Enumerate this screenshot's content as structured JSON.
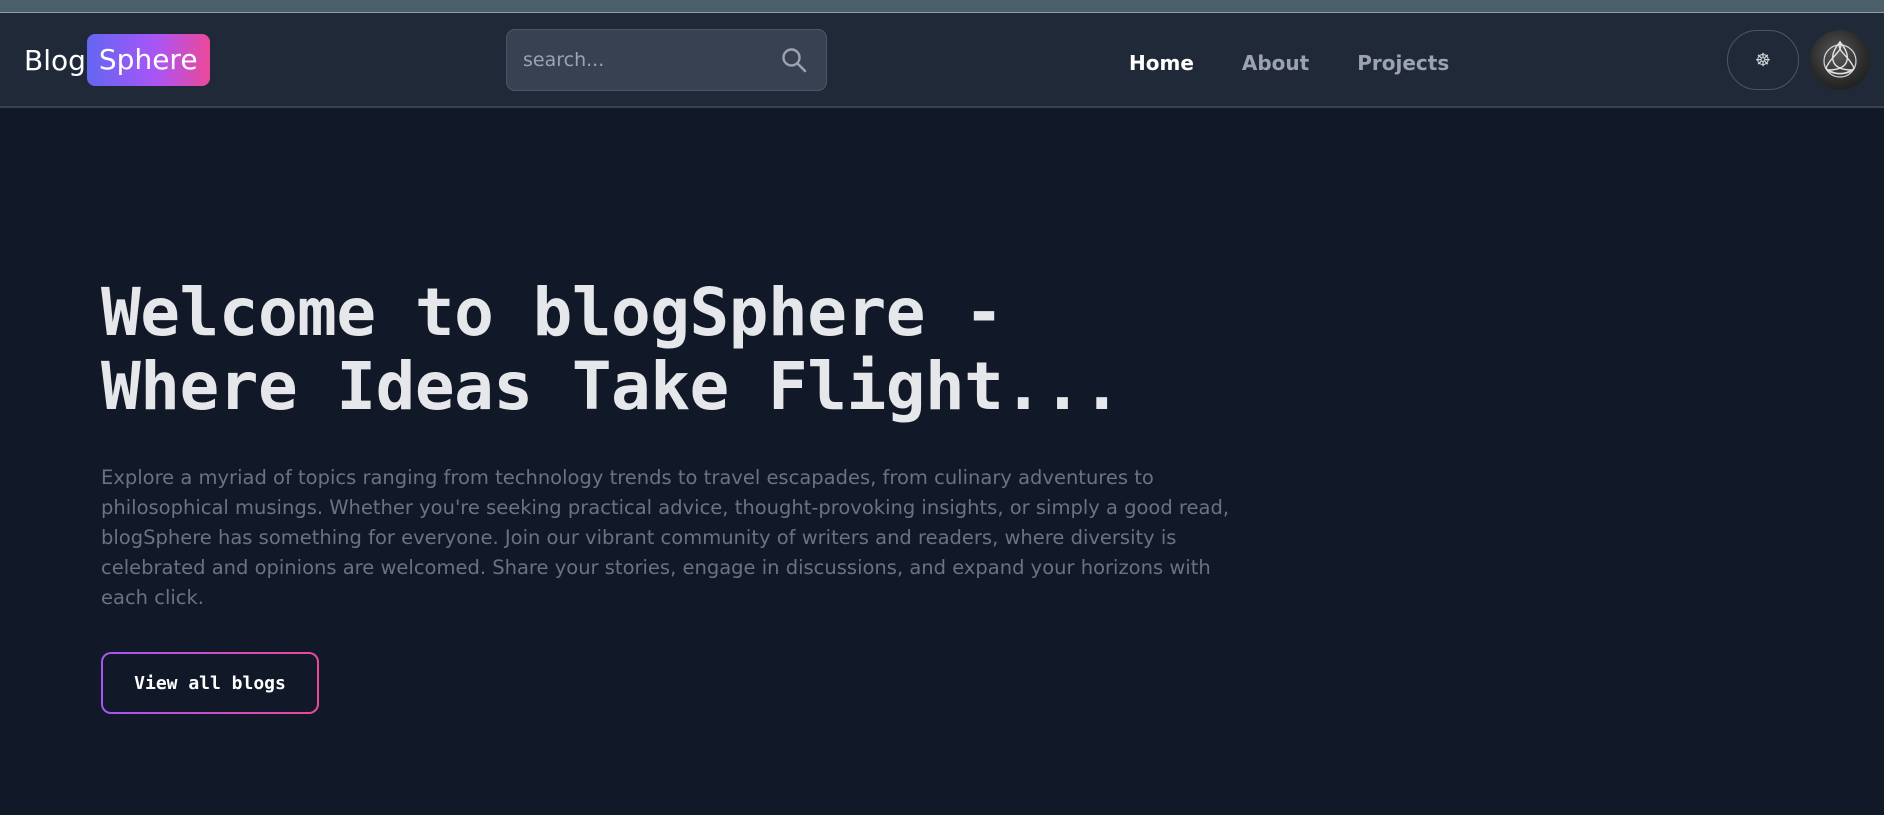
{
  "header": {
    "logo": {
      "part1": "Blog",
      "part2": "Sphere"
    },
    "search": {
      "placeholder": "search...",
      "icon": "search-icon"
    },
    "nav": [
      {
        "label": "Home",
        "active": true
      },
      {
        "label": "About",
        "active": false
      },
      {
        "label": "Projects",
        "active": false
      }
    ],
    "theme_toggle": {
      "icon": "theme-toggle-icon",
      "glyph": "☸"
    },
    "avatar": {
      "icon": "user-avatar"
    }
  },
  "hero": {
    "title_line1": "Welcome to blogSphere -",
    "title_line2": "Where Ideas Take Flight...",
    "description": "Explore a myriad of topics ranging from technology trends to travel escapades, from culinary adventures to philosophical musings. Whether you're seeking practical advice, thought-provoking insights, or simply a good read, blogSphere has something for everyone. Join our vibrant community of writers and readers, where diversity is celebrated and opinions are welcomed. Share your stories, engage in discussions, and expand your horizons with each click.",
    "cta_label": "View all blogs"
  },
  "colors": {
    "background": "#111827",
    "navbar": "#1f2937",
    "accent_start": "#6366f1",
    "accent_mid": "#a855f7",
    "accent_end": "#ec4899"
  }
}
